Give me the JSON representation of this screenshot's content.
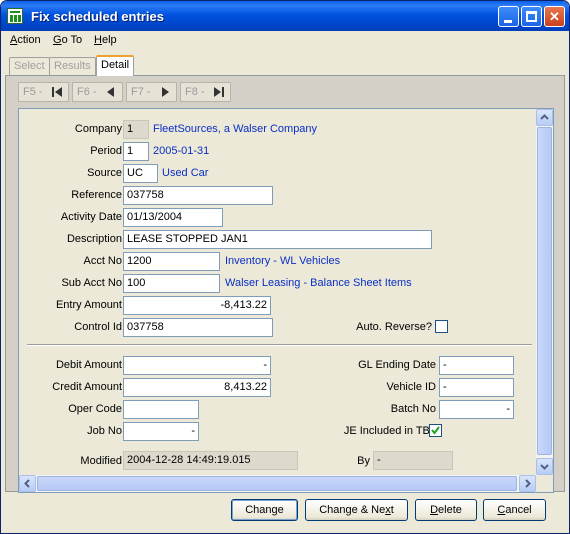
{
  "window": {
    "title": "Fix scheduled entries"
  },
  "menu": [
    {
      "key": "A",
      "rest": "ction"
    },
    {
      "key": "G",
      "rest": "o To"
    },
    {
      "key": "H",
      "rest": "elp"
    }
  ],
  "tabs": [
    "Select",
    "Results",
    "Detail"
  ],
  "nav": [
    "F5 -",
    "F6 -",
    "F7 -",
    "F8 -"
  ],
  "form": {
    "company_label": "Company",
    "company_value": "1",
    "company_name": "FleetSources, a Walser Company",
    "period_label": "Period",
    "period_value": "1",
    "period_date": "2005-01-31",
    "source_label": "Source",
    "source_value": "UC",
    "source_name": "Used Car",
    "reference_label": "Reference",
    "reference_value": "037758",
    "activity_label": "Activity Date",
    "activity_value": "01/13/2004",
    "description_label": "Description",
    "description_value": "LEASE STOPPED JAN1",
    "acct_label": "Acct No",
    "acct_value": "1200",
    "acct_name": "Inventory - WL Vehicles",
    "subacct_label": "Sub Acct No",
    "subacct_value": "100",
    "subacct_name": "Walser Leasing - Balance Sheet Items",
    "entry_label": "Entry Amount",
    "entry_value": "-8,413.22",
    "control_label": "Control Id",
    "control_value": "037758",
    "autorev_label": "Auto. Reverse?",
    "debit_label": "Debit Amount",
    "debit_value": "-",
    "credit_label": "Credit Amount",
    "credit_value": "8,413.22",
    "opercode_label": "Oper Code",
    "opercode_value": "",
    "jobno_label": "Job No",
    "jobno_value": "-",
    "glend_label": "GL Ending Date",
    "glend_value": "-",
    "vehicle_label": "Vehicle ID",
    "vehicle_value": "-",
    "batch_label": "Batch No",
    "batch_value": "-",
    "je_label": "JE Included in TB?",
    "modified_label": "Modified",
    "modified_value": "2004-12-28 14:49:19.015",
    "by_label": "By",
    "by_value": "-"
  },
  "buttons": {
    "change_pre": "Chan",
    "change_key": "g",
    "change_post": "e",
    "changenext_pre": "Change & Ne",
    "changenext_key": "x",
    "changenext_post": "t",
    "delete_pre": "",
    "delete_key": "D",
    "delete_post": "elete",
    "cancel_pre": "",
    "cancel_key": "C",
    "cancel_post": "ancel"
  },
  "colors": {
    "title_bar": "#0054e3",
    "link": "#0a2fc4",
    "tab_accent": "#f0a030"
  }
}
